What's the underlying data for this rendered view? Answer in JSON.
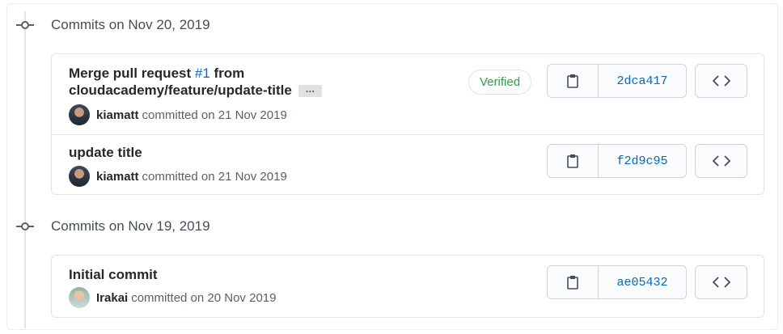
{
  "groups": [
    {
      "title": "Commits on Nov 20, 2019",
      "commits": [
        {
          "title_before": "Merge pull request ",
          "pr_link": "#1",
          "title_after": " from",
          "title_line2": "cloudacademy/feature/update-title",
          "ellipsis": "…",
          "verified": "Verified",
          "author": "kiamatt",
          "committed_text": "committed on 21 Nov 2019",
          "sha": "2dca417",
          "avatar_icon": "avatar-kiamatt"
        },
        {
          "title": "update title",
          "author": "kiamatt",
          "committed_text": "committed on 21 Nov 2019",
          "sha": "f2d9c95",
          "avatar_icon": "avatar-kiamatt"
        }
      ]
    },
    {
      "title": "Commits on Nov 19, 2019",
      "commits": [
        {
          "title": "Initial commit",
          "author": "Irakai",
          "committed_text": "committed on 20 Nov 2019",
          "sha": "ae05432",
          "avatar_icon": "avatar-irakai"
        }
      ]
    }
  ],
  "icons": {
    "copy": "clipboard-icon",
    "browse": "code-icon",
    "timeline": "git-commit-icon"
  },
  "colors": {
    "link": "#0366d6",
    "verified": "#28a745",
    "border": "#e1e4e8"
  }
}
